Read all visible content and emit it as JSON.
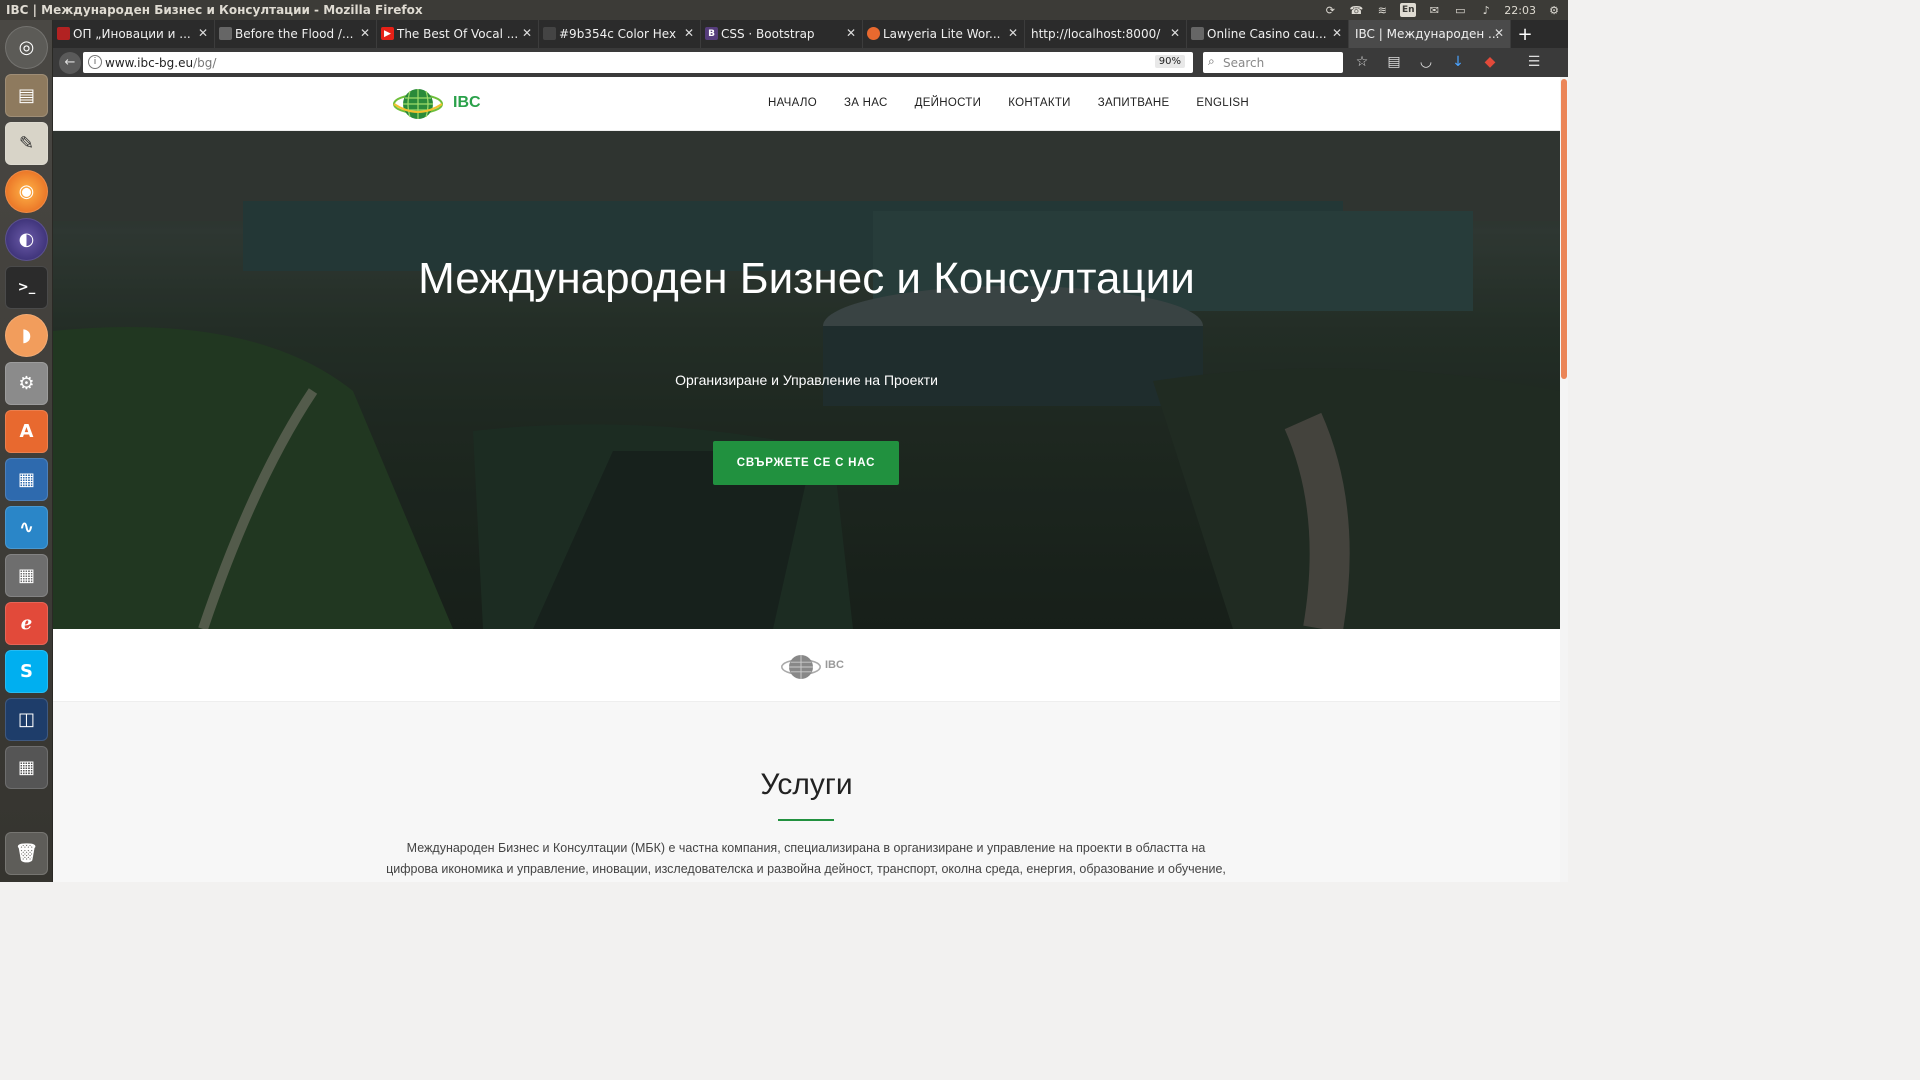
{
  "os": {
    "window_title": "IBC | Международен Бизнес и Консултации - Mozilla Firefox",
    "clock": "22:03",
    "keyboard_layout": "En"
  },
  "browser": {
    "tabs": [
      {
        "label": "ОП „Иновации и ...",
        "icon": "tab-favicon",
        "color": "#b22222"
      },
      {
        "label": "Before the Flood /...",
        "icon": "tab-favicon",
        "color": "#666666"
      },
      {
        "label": "The Best Of Vocal ...",
        "icon": "youtube-icon",
        "color": "#e62117"
      },
      {
        "label": "#9b354c Color Hex",
        "icon": "tab-favicon",
        "color": "#9b354c"
      },
      {
        "label": "CSS · Bootstrap",
        "icon": "bootstrap-icon",
        "color": "#563d7c"
      },
      {
        "label": "Lawyeria Lite Wor...",
        "icon": "tab-favicon",
        "color": "#e8692f"
      },
      {
        "label": "http://localhost:8000/",
        "icon": "tab-favicon",
        "color": "#666666"
      },
      {
        "label": "Online Casino cau...",
        "icon": "tab-favicon",
        "color": "#666666"
      },
      {
        "label": "IBC | Международен ...",
        "icon": "tab-favicon",
        "color": "#2aa14a",
        "active": true
      }
    ],
    "url_host": "www.ibc-bg.eu",
    "url_path": "/bg/",
    "zoom": "90%",
    "search_placeholder": "Search"
  },
  "site": {
    "logo_text": "IBC",
    "nav": [
      "НАЧАЛО",
      "ЗА НАС",
      "ДЕЙНОСТИ",
      "КОНТАКТИ",
      "ЗАПИТВАНЕ",
      "ENGLISH"
    ],
    "hero_title": "Международен Бизнес и Консултации",
    "hero_subtitle": "Организиране и Управление на Проекти",
    "cta_label": "СВЪРЖЕТЕ СЕ С НАС",
    "brand_text": "IBC",
    "services_title": "Услуги",
    "services_text": "Международен Бизнес и Консултации (МБК) е частна компания, специализирана в организиране и управление на проекти в областта на цифрова икономика и управление, иновации, изследователска и развойна дейност, транспорт, околна среда, енергия, образование и обучение, туризъм, културни",
    "accent_color": "#21913f"
  }
}
